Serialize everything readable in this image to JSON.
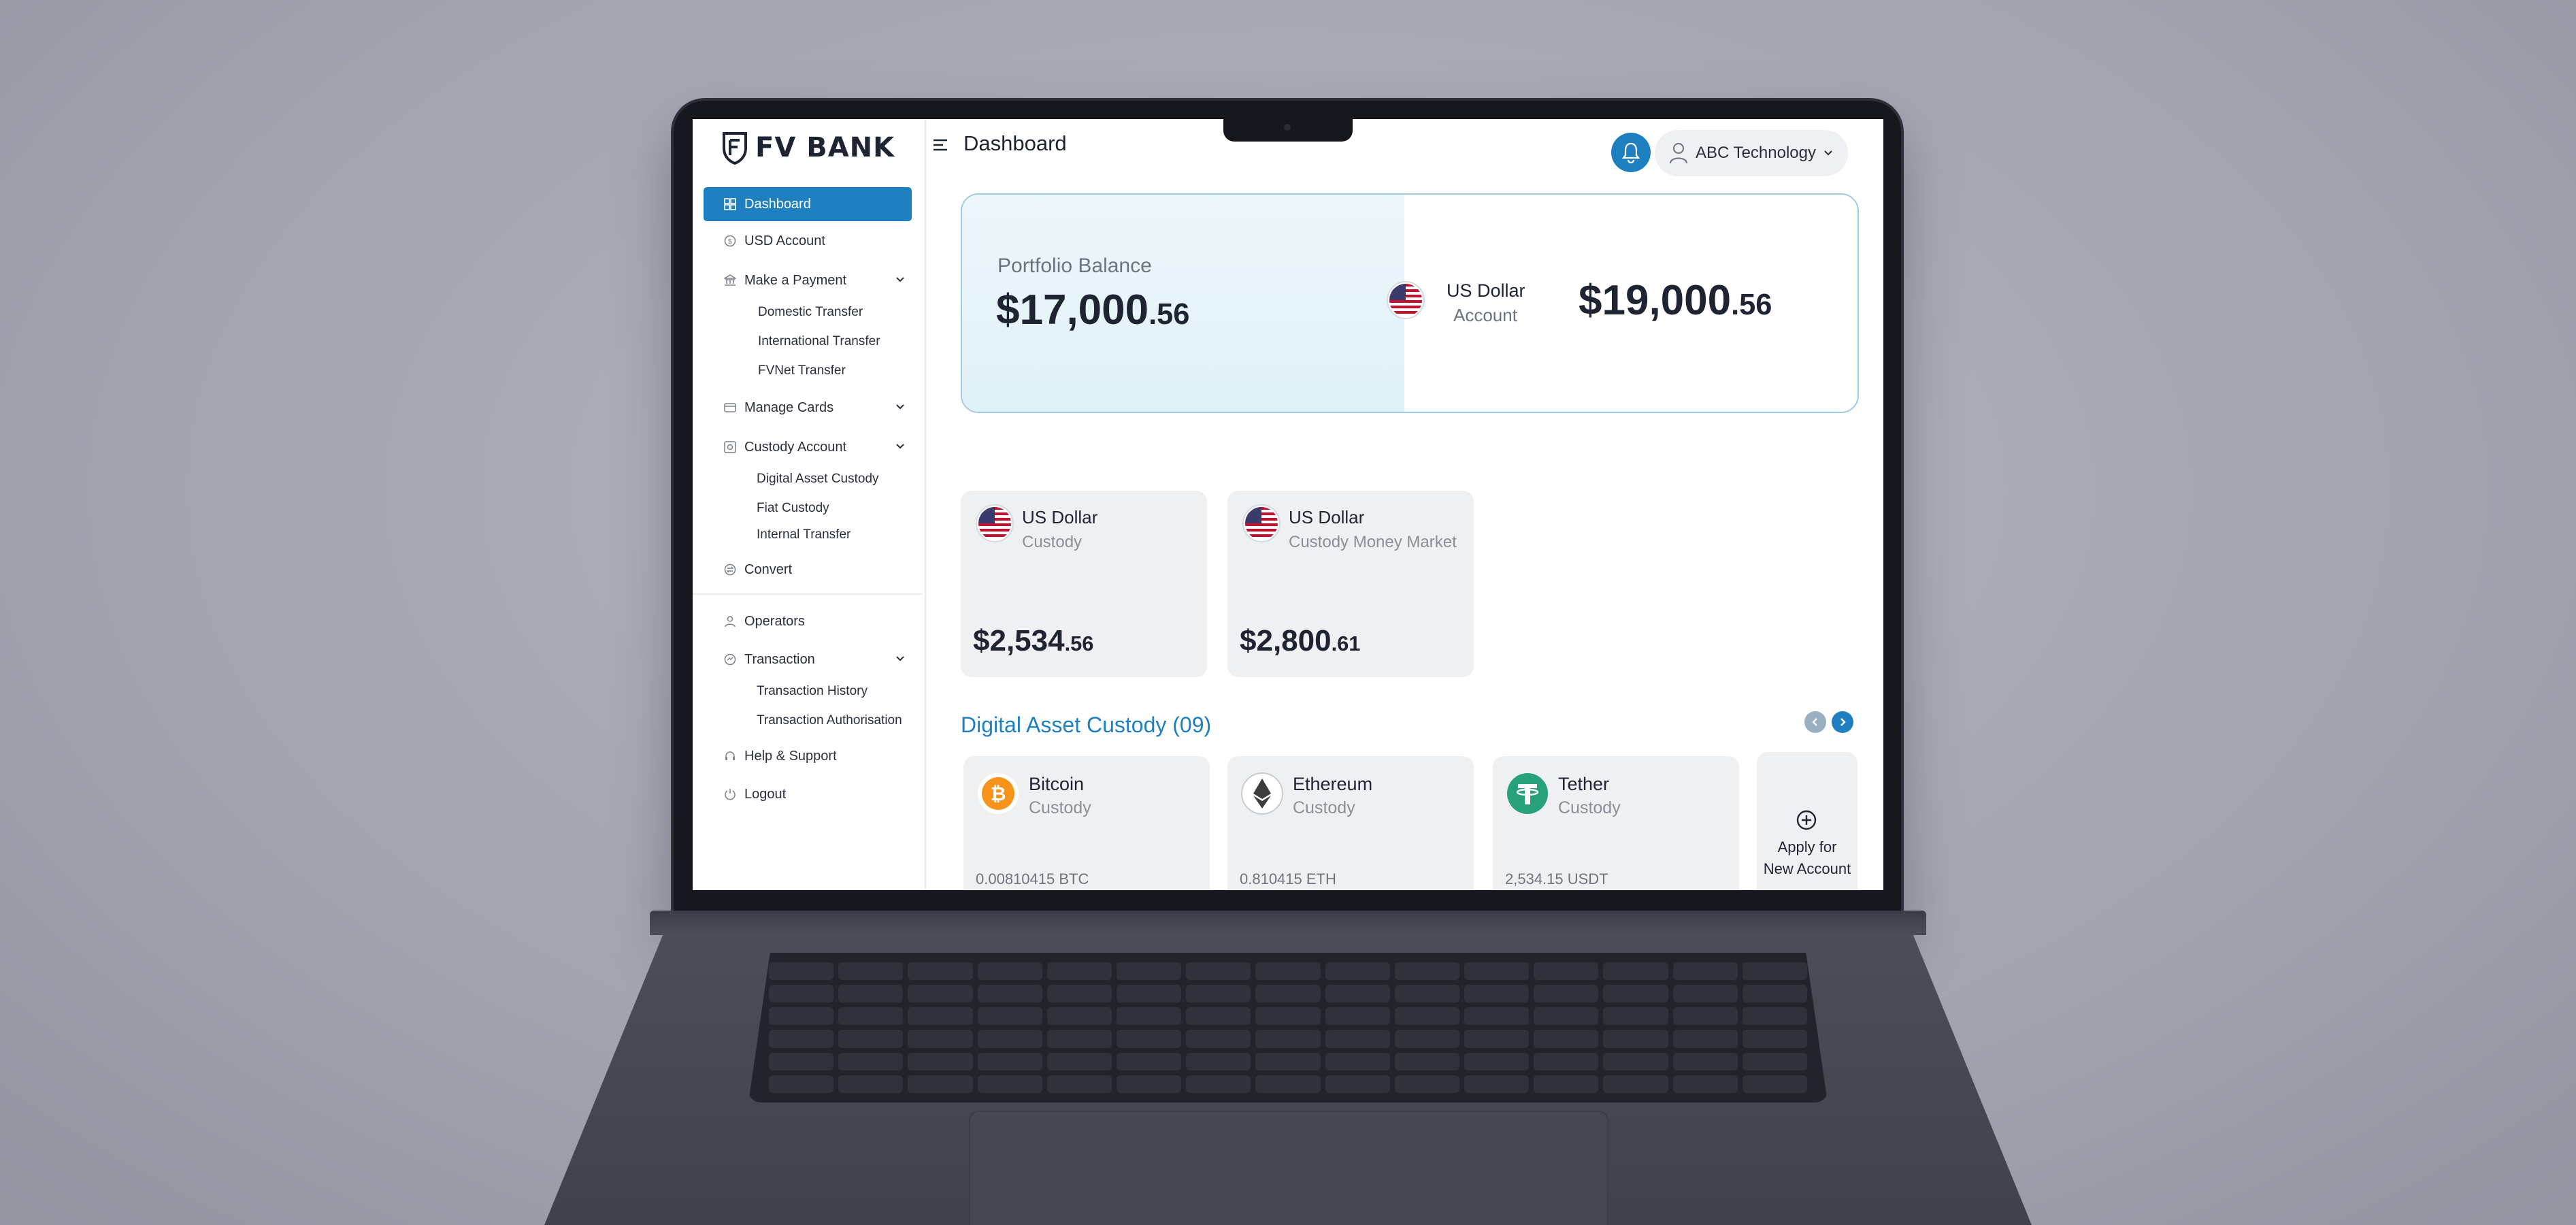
{
  "brand": {
    "name": "FV BANK"
  },
  "header": {
    "title": "Dashboard",
    "user_name": "ABC Technology"
  },
  "sidebar": {
    "items": [
      {
        "label": "Dashboard",
        "icon": "grid-icon",
        "active": true
      },
      {
        "label": "USD Account",
        "icon": "dollar-circle-icon"
      },
      {
        "label": "Make a Payment",
        "icon": "bank-icon",
        "expanded": true
      },
      {
        "label": "Domestic Transfer"
      },
      {
        "label": "International Transfer"
      },
      {
        "label": "FVNet Transfer"
      },
      {
        "label": "Manage Cards",
        "icon": "card-icon"
      },
      {
        "label": "Custody Account",
        "icon": "vault-icon",
        "expanded": true
      },
      {
        "label": "Digital Asset Custody"
      },
      {
        "label": "Fiat Custody"
      },
      {
        "label": "Internal Transfer"
      },
      {
        "label": "Convert",
        "icon": "convert-icon"
      },
      {
        "label": "Operators",
        "icon": "user-icon"
      },
      {
        "label": "Transaction",
        "icon": "transaction-icon",
        "expanded": true
      },
      {
        "label": "Transaction History"
      },
      {
        "label": "Transaction Authorisation"
      },
      {
        "label": "Help & Support",
        "icon": "headset-icon"
      },
      {
        "label": "Logout",
        "icon": "power-icon"
      }
    ]
  },
  "portfolio": {
    "label": "Portfolio Balance",
    "amount_main": "$17,000",
    "amount_cents": ".56",
    "usd_account": {
      "name": "US Dollar",
      "sub": "Account",
      "amount_main": "$19,000",
      "amount_cents": ".56"
    }
  },
  "custody": [
    {
      "title": "US Dollar",
      "sub": "Custody",
      "amount_main": "$2,534",
      "amount_cents": ".56"
    },
    {
      "title": "US Dollar",
      "sub": "Custody Money Market",
      "amount_main": "$2,800",
      "amount_cents": ".61"
    }
  ],
  "digital": {
    "title": "Digital Asset Custody (09)",
    "assets": [
      {
        "title": "Bitcoin",
        "sub": "Custody",
        "qty": "0.00810415 BTC",
        "color": "#f7931a"
      },
      {
        "title": "Ethereum",
        "sub": "Custody",
        "qty": "0.810415 ETH",
        "color": "#3c3c3d"
      },
      {
        "title": "Tether",
        "sub": "Custody",
        "qty": "2,534.15 USDT",
        "color": "#26a17b"
      }
    ],
    "apply": {
      "line1": "Apply for",
      "line2": "New Account"
    }
  },
  "colors": {
    "accent": "#1e7fc1",
    "card_bg": "#eef0f2",
    "portfolio_border": "#9fcbe6"
  }
}
